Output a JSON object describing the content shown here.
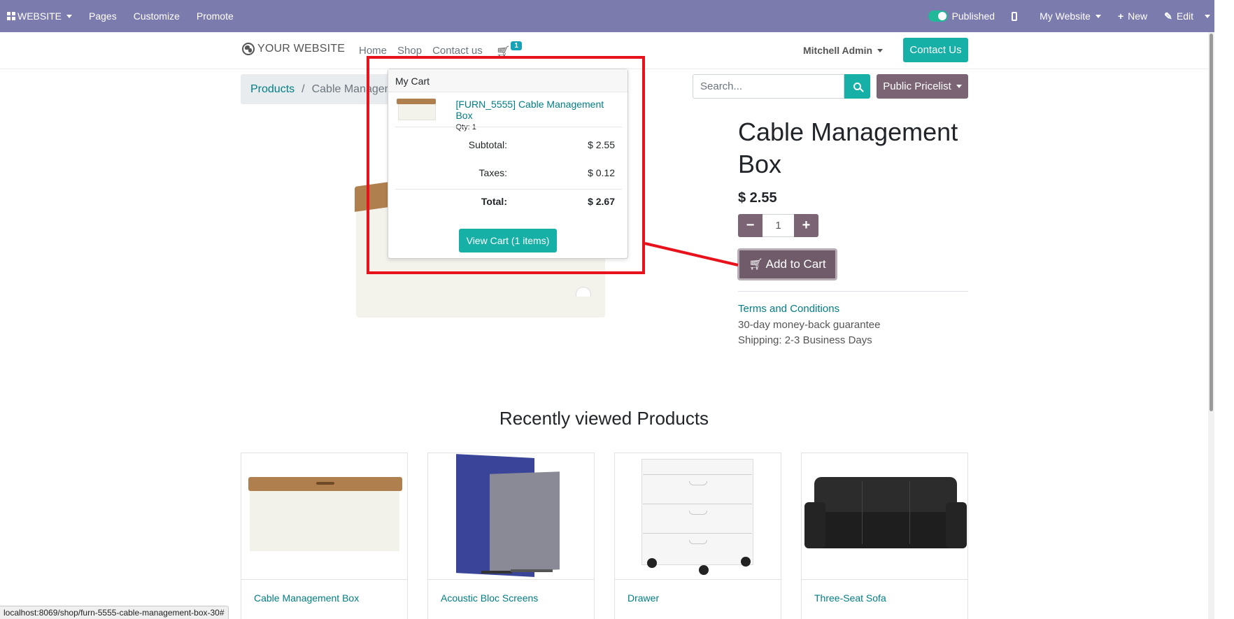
{
  "admin_bar": {
    "app_label": "WEBSITE",
    "menu": [
      "Pages",
      "Customize",
      "Promote"
    ],
    "published_label": "Published",
    "website_label": "My Website",
    "new_label": "New",
    "edit_label": "Edit"
  },
  "header": {
    "logo_text": "YOUR WEBSITE",
    "nav": [
      "Home",
      "Shop",
      "Contact us"
    ],
    "cart_count": "1",
    "user": "Mitchell Admin",
    "contact_button": "Contact Us"
  },
  "breadcrumb": {
    "parent": "Products",
    "separator": "/",
    "current": "Cable Management Box"
  },
  "search": {
    "placeholder": "Search...",
    "pricelist_label": "Public Pricelist"
  },
  "product": {
    "title": "Cable Management Box",
    "price": "$ 2.55",
    "qty": "1",
    "add_to_cart_label": "Add to Cart",
    "terms_link": "Terms and Conditions",
    "guarantee": "30-day money-back guarantee",
    "shipping": "Shipping: 2-3 Business Days"
  },
  "cart_popover": {
    "header": "My Cart",
    "item_name": "[FURN_5555] Cable Management Box",
    "item_qty": "Qty: 1",
    "subtotal_label": "Subtotal:",
    "subtotal_value": "$ 2.55",
    "taxes_label": "Taxes:",
    "taxes_value": "$ 0.12",
    "total_label": "Total:",
    "total_value": "$ 2.67",
    "view_cart_label": "View Cart (1 items)"
  },
  "recently_viewed": {
    "title": "Recently viewed Products",
    "items": [
      "Cable Management Box",
      "Acoustic Bloc Screens",
      "Drawer",
      "Three-Seat Sofa"
    ]
  },
  "status_bar": {
    "url": "localhost:8069/shop/furn-5555-cable-management-box-30#"
  },
  "colors": {
    "admin_bar": "#7c7bad",
    "primary_teal": "#17b0a6",
    "secondary_mauve": "#7b6474",
    "link": "#017e84",
    "annotation_red": "#e8121d"
  }
}
